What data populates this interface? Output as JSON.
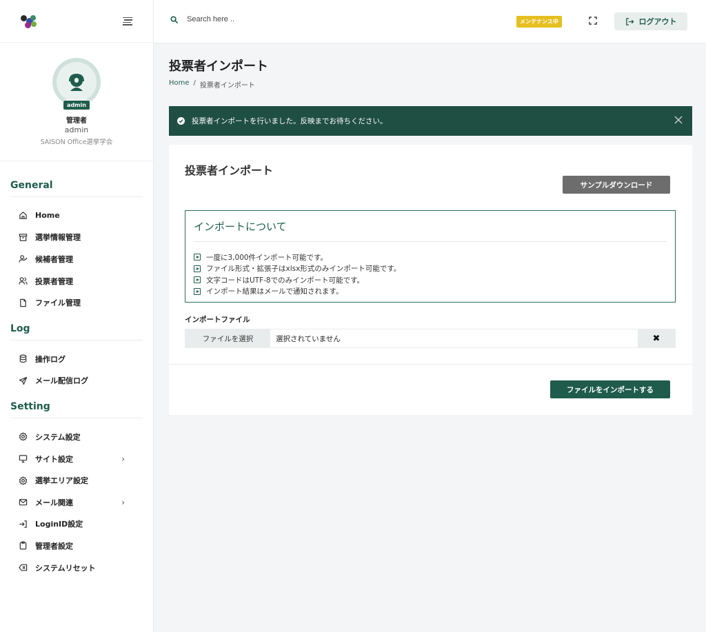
{
  "header": {
    "search_placeholder": "Search here ..",
    "maintenance_badge": "メンテナンス中",
    "logout_label": "ログアウト"
  },
  "profile": {
    "badge": "admin",
    "role": "管理者",
    "username": "admin",
    "organization": "SAISON Office選挙学会"
  },
  "sidebar": {
    "sections": [
      {
        "title": "General",
        "items": [
          {
            "label": "Home",
            "icon": "home-icon"
          },
          {
            "label": "選挙情報管理",
            "icon": "archive-icon"
          },
          {
            "label": "候補者管理",
            "icon": "user-check-icon"
          },
          {
            "label": "投票者管理",
            "icon": "users-icon"
          },
          {
            "label": "ファイル管理",
            "icon": "file-icon"
          }
        ]
      },
      {
        "title": "Log",
        "items": [
          {
            "label": "操作ログ",
            "icon": "database-icon"
          },
          {
            "label": "メール配信ログ",
            "icon": "send-icon"
          }
        ]
      },
      {
        "title": "Setting",
        "items": [
          {
            "label": "システム設定",
            "icon": "gear-icon"
          },
          {
            "label": "サイト設定",
            "icon": "monitor-icon",
            "has_submenu": true
          },
          {
            "label": "選挙エリア設定",
            "icon": "gear-icon"
          },
          {
            "label": "メール関連",
            "icon": "mail-icon",
            "has_submenu": true
          },
          {
            "label": "LoginID設定",
            "icon": "login-icon"
          },
          {
            "label": "管理者設定",
            "icon": "clipboard-icon"
          },
          {
            "label": "システムリセット",
            "icon": "backspace-icon"
          }
        ]
      }
    ]
  },
  "page": {
    "title": "投票者インポート",
    "breadcrumb_home": "Home",
    "breadcrumb_sep": "/",
    "breadcrumb_current": "投票者インポート"
  },
  "alert": {
    "message": "投票者インポートを行いました。反映までお待ちください。"
  },
  "card": {
    "title": "投票者インポート",
    "sample_download_label": "サンプルダウンロード",
    "info_title": "インポートについて",
    "info_items": [
      "一度に3,000件インポート可能です。",
      "ファイル形式・拡張子はxlsx形式のみインポート可能です。",
      "文字コードはUTF-8でのみインポート可能です。",
      "インポート結果はメールで通知されます。"
    ],
    "file_label": "インポートファイル",
    "file_select_label": "ファイルを選択",
    "file_status": "選択されていません",
    "clear_symbol": "✖",
    "import_button_label": "ファイルをインポートする"
  },
  "colors": {
    "primary": "#1f5c4c",
    "alert_bg": "#1f4f42",
    "maintenance": "#e5bf1f",
    "sample_button": "#6d6d6d"
  }
}
